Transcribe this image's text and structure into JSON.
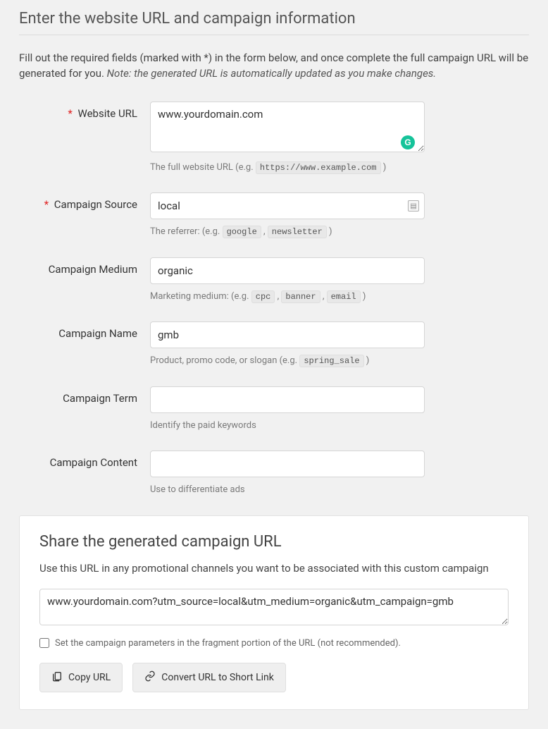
{
  "header": {
    "title": "Enter the website URL and campaign information"
  },
  "intro": {
    "text": "Fill out the required fields (marked with *) in the form below, and once complete the full campaign URL will be generated for you. ",
    "note": "Note: the generated URL is automatically updated as you make changes."
  },
  "fields": {
    "website_url": {
      "label": "Website URL",
      "required": "*",
      "value": "www.yourdomain.com",
      "help_prefix": "The full website URL (e.g. ",
      "help_code": "https://www.example.com",
      "help_suffix": " )"
    },
    "campaign_source": {
      "label": "Campaign Source",
      "required": "*",
      "value": "local",
      "help_prefix": "The referrer: (e.g. ",
      "help_code1": "google",
      "help_sep": " , ",
      "help_code2": "newsletter",
      "help_suffix": " )"
    },
    "campaign_medium": {
      "label": "Campaign Medium",
      "value": "organic",
      "help_prefix": "Marketing medium: (e.g. ",
      "help_code1": "cpc",
      "help_sep1": " , ",
      "help_code2": "banner",
      "help_sep2": " , ",
      "help_code3": "email",
      "help_suffix": " )"
    },
    "campaign_name": {
      "label": "Campaign Name",
      "value": "gmb",
      "help_prefix": "Product, promo code, or slogan (e.g. ",
      "help_code": "spring_sale",
      "help_suffix": " )"
    },
    "campaign_term": {
      "label": "Campaign Term",
      "value": "",
      "help": "Identify the paid keywords"
    },
    "campaign_content": {
      "label": "Campaign Content",
      "value": "",
      "help": "Use to differentiate ads"
    }
  },
  "share": {
    "title": "Share the generated campaign URL",
    "desc": "Use this URL in any promotional channels you want to be associated with this custom campaign",
    "generated_url": "www.yourdomain.com?utm_source=local&utm_medium=organic&utm_campaign=gmb",
    "fragment_label": "Set the campaign parameters in the fragment portion of the URL (not recommended).",
    "copy_button": "Copy URL",
    "shortlink_button": "Convert URL to Short Link"
  }
}
